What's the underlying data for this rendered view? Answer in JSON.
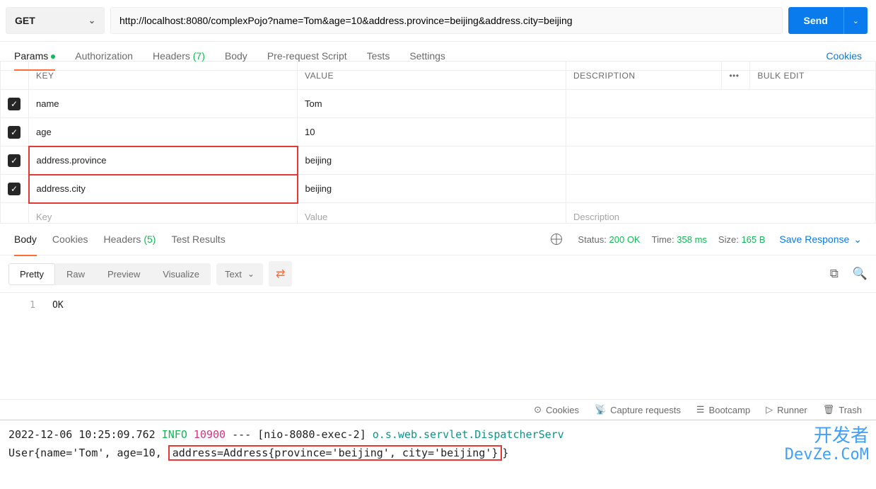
{
  "request": {
    "method": "GET",
    "url": "http://localhost:8080/complexPojo?name=Tom&age=10&address.province=beijing&address.city=beijing",
    "send": "Send"
  },
  "tabs": {
    "params": "Params",
    "authorization": "Authorization",
    "headers": "Headers",
    "headers_count": "(7)",
    "body": "Body",
    "prerequest": "Pre-request Script",
    "tests": "Tests",
    "settings": "Settings",
    "cookies": "Cookies"
  },
  "params": {
    "header_key": "KEY",
    "header_value": "VALUE",
    "header_desc": "DESCRIPTION",
    "bulk_edit": "Bulk Edit",
    "rows": [
      {
        "key": "name",
        "value": "Tom",
        "highlight": false
      },
      {
        "key": "age",
        "value": "10",
        "highlight": false
      },
      {
        "key": "address.province",
        "value": "beijing",
        "highlight": true
      },
      {
        "key": "address.city",
        "value": "beijing",
        "highlight": true
      }
    ],
    "placeholder_key": "Key",
    "placeholder_value": "Value",
    "placeholder_desc": "Description"
  },
  "response": {
    "tabs": {
      "body": "Body",
      "cookies": "Cookies",
      "headers": "Headers",
      "headers_count": "(5)",
      "tests": "Test Results"
    },
    "status_label": "Status:",
    "status_value": "200 OK",
    "time_label": "Time:",
    "time_value": "358 ms",
    "size_label": "Size:",
    "size_value": "165 B",
    "save": "Save Response",
    "views": {
      "pretty": "Pretty",
      "raw": "Raw",
      "preview": "Preview",
      "visualize": "Visualize"
    },
    "format": "Text",
    "body_line": "1",
    "body_text": "OK"
  },
  "footer": {
    "cookies": "Cookies",
    "capture": "Capture requests",
    "bootcamp": "Bootcamp",
    "runner": "Runner",
    "trash": "Trash"
  },
  "console": {
    "line1_prefix": "2022-12-06 10:25:09.762",
    "line1_info": " INFO ",
    "line1_pid": "10900",
    "line1_thread": "[nio-8080-exec-2]",
    "line1_class": "o.s.web.servlet.DispatcherServ",
    "line2_prefix": "User{name='Tom', age=10, ",
    "line2_highlight": "address=Address{province='beijing', city='beijing'}",
    "line2_suffix": "}"
  },
  "watermark": {
    "cn": "开发者",
    "en": "DevZe.CoM"
  }
}
